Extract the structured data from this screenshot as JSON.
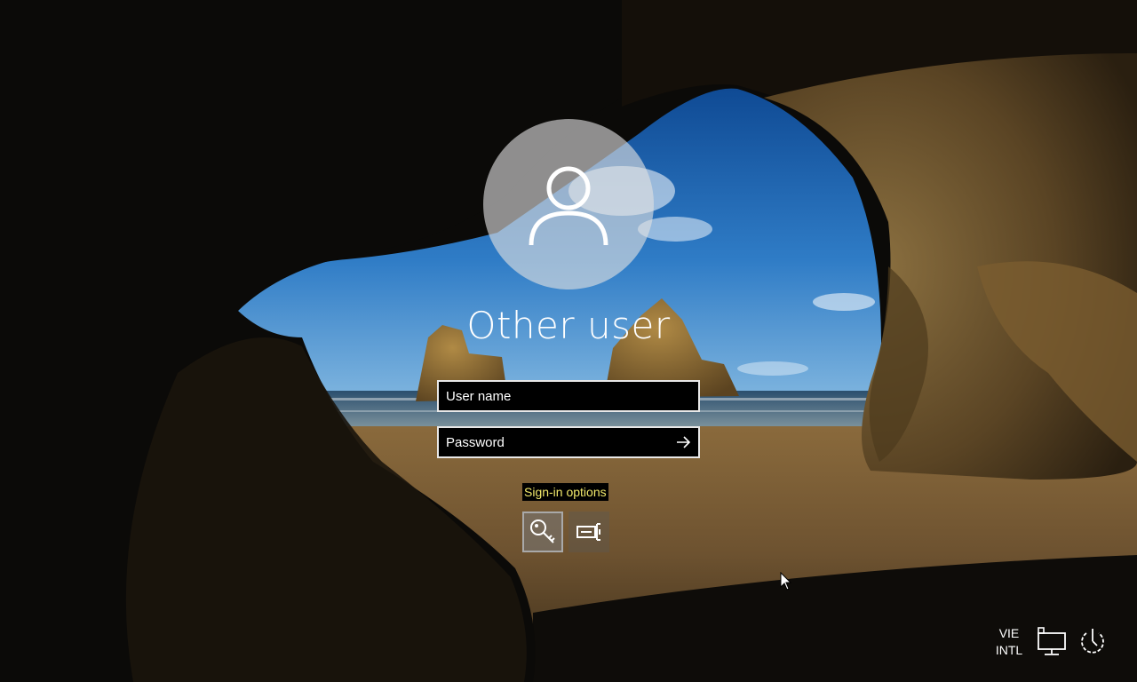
{
  "login": {
    "user_display_name": "Other user",
    "username_placeholder": "User name",
    "username_value": "",
    "password_placeholder": "Password",
    "password_value": "",
    "signin_options_label": "Sign-in options"
  },
  "signin_options": [
    {
      "name": "password-key-option",
      "icon": "key-icon"
    },
    {
      "name": "smart-card-option",
      "icon": "smart-card-icon"
    }
  ],
  "tray": {
    "language_line1": "VIE",
    "language_line2": "INTL",
    "network_icon": "network-icon",
    "power_icon": "power-icon"
  },
  "colors": {
    "field_background": "#000000",
    "field_border": "#e8e8e8",
    "signin_options_text": "#f1e86b",
    "text": "#ffffff"
  }
}
